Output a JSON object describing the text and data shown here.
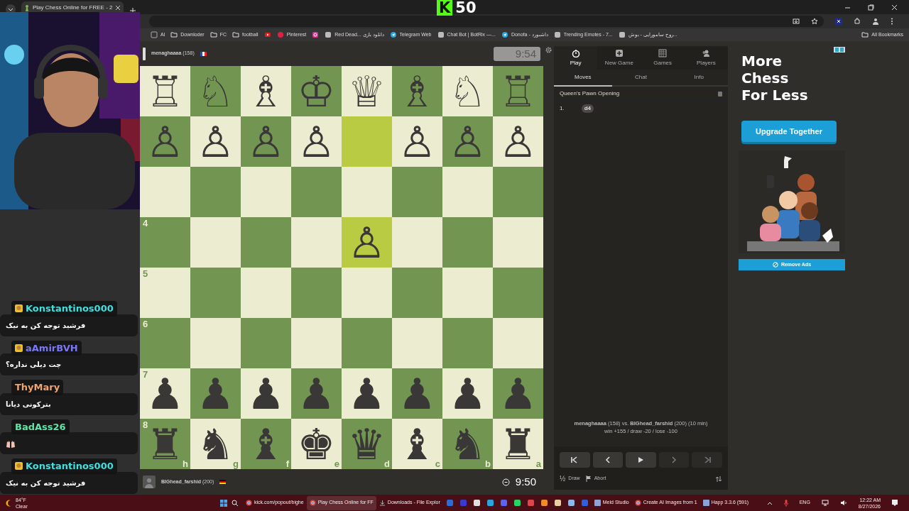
{
  "browser": {
    "tabs": [
      {
        "title": "Play Chess Online for FREE - 2",
        "selected": true
      }
    ],
    "bookmarks": [
      {
        "kind": "plain",
        "label": "Al"
      },
      {
        "kind": "folder",
        "label": "Downloder"
      },
      {
        "kind": "folder",
        "label": "FC"
      },
      {
        "kind": "folder",
        "label": "football"
      },
      {
        "kind": "youtube"
      },
      {
        "kind": "pinterest",
        "label": "Pinterest"
      },
      {
        "kind": "instagram"
      },
      {
        "kind": "site",
        "label": "Red Dead... دانلود بازی"
      },
      {
        "kind": "telegram",
        "label": "Telegram Web"
      },
      {
        "kind": "site",
        "label": "Chat Bot | BotRix —..."
      },
      {
        "kind": "telegram",
        "label": "Donofa - داشبورد"
      },
      {
        "kind": "site",
        "label": "Trending Emotes - 7..."
      },
      {
        "kind": "site",
        "label": "روح سامورایی - بوش..."
      }
    ],
    "all_bookmarks": "All Bookmarks"
  },
  "stream_overlay": {
    "logo_letter": "K",
    "count": "50",
    "chat": [
      {
        "user": "Konstantinos000",
        "color": "#3fe0e0",
        "badge": true,
        "kind": "text",
        "message": "فرشید توجه کن به نیک"
      },
      {
        "user": "aAmirBVH",
        "color": "#7b78f0",
        "badge": true,
        "kind": "text",
        "message": "چت دیلی نداره؟"
      },
      {
        "user": "ThyMary",
        "color": "#f2a46e",
        "badge": false,
        "kind": "text",
        "message": "بترکونی دیانا"
      },
      {
        "user": "BadAss26",
        "color": "#5fe3a8",
        "badge": false,
        "kind": "emote"
      },
      {
        "user": "Konstantinos000",
        "color": "#3fe0e0",
        "badge": true,
        "kind": "text",
        "message": "فرشید توجه کن به نیک"
      }
    ]
  },
  "game": {
    "top_player": {
      "name": "menaghaaaa",
      "rating": "(158)",
      "clock": "9:54",
      "running": false
    },
    "bottom_player": {
      "name": "BIGhead_farshid",
      "rating": "(200)",
      "clock": "9:50",
      "running": true
    },
    "board": {
      "rows": [
        {
          "cells": [
            {
              "piece": "♖",
              "highlighted": false
            },
            {
              "piece": "♘",
              "highlighted": false
            },
            {
              "piece": "♗",
              "highlighted": false
            },
            {
              "piece": "♔",
              "highlighted": false
            },
            {
              "piece": "♕",
              "highlighted": false
            },
            {
              "piece": "♗",
              "highlighted": false
            },
            {
              "piece": "♘",
              "highlighted": false
            },
            {
              "piece": "♖",
              "highlighted": false
            }
          ]
        },
        {
          "cells": [
            {
              "piece": "♙",
              "highlighted": false
            },
            {
              "piece": "♙",
              "highlighted": false
            },
            {
              "piece": "♙",
              "highlighted": false
            },
            {
              "piece": "♙",
              "highlighted": false
            },
            {
              "highlighted": true
            },
            {
              "piece": "♙",
              "highlighted": false
            },
            {
              "piece": "♙",
              "highlighted": false
            },
            {
              "piece": "♙",
              "highlighted": false
            }
          ]
        },
        {
          "cells": [
            {
              "highlighted": false
            },
            {
              "highlighted": false
            },
            {
              "highlighted": false
            },
            {
              "highlighted": false
            },
            {
              "highlighted": false
            },
            {
              "highlighted": false
            },
            {
              "highlighted": false
            },
            {
              "highlighted": false
            }
          ]
        },
        {
          "cells": [
            {
              "rank_label": "4",
              "highlighted": false
            },
            {
              "highlighted": false
            },
            {
              "highlighted": false
            },
            {
              "highlighted": false
            },
            {
              "piece": "♙",
              "highlighted": true
            },
            {
              "highlighted": false
            },
            {
              "highlighted": false
            },
            {
              "highlighted": false
            }
          ]
        },
        {
          "cells": [
            {
              "rank_label": "5",
              "highlighted": false
            },
            {
              "highlighted": false
            },
            {
              "highlighted": false
            },
            {
              "highlighted": false
            },
            {
              "highlighted": false
            },
            {
              "highlighted": false
            },
            {
              "highlighted": false
            },
            {
              "highlighted": false
            }
          ]
        },
        {
          "cells": [
            {
              "rank_label": "6",
              "highlighted": false
            },
            {
              "highlighted": false
            },
            {
              "highlighted": false
            },
            {
              "highlighted": false
            },
            {
              "highlighted": false
            },
            {
              "highlighted": false
            },
            {
              "highlighted": false
            },
            {
              "highlighted": false
            }
          ]
        },
        {
          "cells": [
            {
              "rank_label": "7",
              "piece": "♟",
              "highlighted": false
            },
            {
              "piece": "♟",
              "highlighted": false
            },
            {
              "piece": "♟",
              "highlighted": false
            },
            {
              "piece": "♟",
              "highlighted": false
            },
            {
              "piece": "♟",
              "highlighted": false
            },
            {
              "piece": "♟",
              "highlighted": false
            },
            {
              "piece": "♟",
              "highlighted": false
            },
            {
              "piece": "♟",
              "highlighted": false
            }
          ]
        },
        {
          "cells": [
            {
              "rank_label": "8",
              "piece": "♜",
              "file_label": "h",
              "highlighted": false
            },
            {
              "piece": "♞",
              "file_label": "g",
              "highlighted": false
            },
            {
              "piece": "♝",
              "file_label": "f",
              "highlighted": false
            },
            {
              "piece": "♚",
              "file_label": "e",
              "highlighted": false
            },
            {
              "piece": "♛",
              "file_label": "d",
              "highlighted": false
            },
            {
              "piece": "♝",
              "file_label": "c",
              "highlighted": false
            },
            {
              "piece": "♞",
              "file_label": "b",
              "highlighted": false
            },
            {
              "piece": "♜",
              "file_label": "a",
              "highlighted": false
            }
          ]
        }
      ]
    }
  },
  "panel": {
    "nav": [
      {
        "kind": "play",
        "label": "Play",
        "selected": true
      },
      {
        "kind": "new",
        "label": "New Game",
        "selected": false
      },
      {
        "kind": "games",
        "label": "Games",
        "selected": false
      },
      {
        "kind": "players",
        "label": "Players",
        "selected": false
      }
    ],
    "tabs": [
      {
        "label": "Moves",
        "selected": true
      },
      {
        "label": "Chat",
        "selected": false
      },
      {
        "label": "Info",
        "selected": false
      }
    ],
    "opening": "Queen's Pawn Opening",
    "moves": [
      {
        "number": "1.",
        "white": "d4"
      }
    ],
    "summary": "**menaghaaaa** (158) vs. **BIGhead_farshid** (200) (10 min)",
    "stakes": "win +155 / draw -20 / lose -100",
    "controls": [
      {
        "kind": "first",
        "disabled": false
      },
      {
        "kind": "prev",
        "disabled": false
      },
      {
        "kind": "play",
        "disabled": false
      },
      {
        "kind": "next",
        "disabled": true
      },
      {
        "kind": "last",
        "disabled": true
      }
    ],
    "draw_symbol": "½",
    "draw": "Draw",
    "abort": "Abort"
  },
  "ad": {
    "headline": [
      "More",
      "Chess",
      "For Less"
    ],
    "button": "Upgrade Together",
    "illustration": {
      "kind": "picture"
    },
    "remove": "Remove Ads"
  },
  "taskbar": {
    "weather": {
      "temp": "84°F",
      "condition": "Clear"
    },
    "apps": [
      {
        "kind": "chrome",
        "label": "kick.com/popout/bighe",
        "selected": false
      },
      {
        "kind": "chrome",
        "label": "Play Chess Online for FF",
        "selected": true
      },
      {
        "kind": "folder",
        "label": "Downloads - File Explor",
        "selected": false
      },
      {
        "kind": "icon",
        "color": "#2b6cd8"
      },
      {
        "kind": "icon",
        "color": "#3a3ad0"
      },
      {
        "kind": "icon",
        "color": "#e0e0e0"
      },
      {
        "kind": "icon",
        "color": "#2aa3de"
      },
      {
        "kind": "icon",
        "color": "#5865f2"
      },
      {
        "kind": "icon",
        "color": "#25d366"
      },
      {
        "kind": "icon",
        "color": "#e0454a"
      },
      {
        "kind": "icon",
        "color": "#f08c2c"
      },
      {
        "kind": "icon",
        "color": "#e8d0a0"
      },
      {
        "kind": "icon",
        "color": "#8fb8e8"
      },
      {
        "kind": "icon",
        "color": "#3060e0"
      },
      {
        "kind": "app",
        "label": "Meld Studio",
        "selected": false
      },
      {
        "kind": "chrome",
        "label": "Create AI Images from 1",
        "selected": false
      },
      {
        "kind": "app",
        "label": "Happ 3.3.6 (591)",
        "selected": false
      }
    ],
    "language": "ENG",
    "time": "12:22 AM",
    "date": "8/27/2026"
  }
}
